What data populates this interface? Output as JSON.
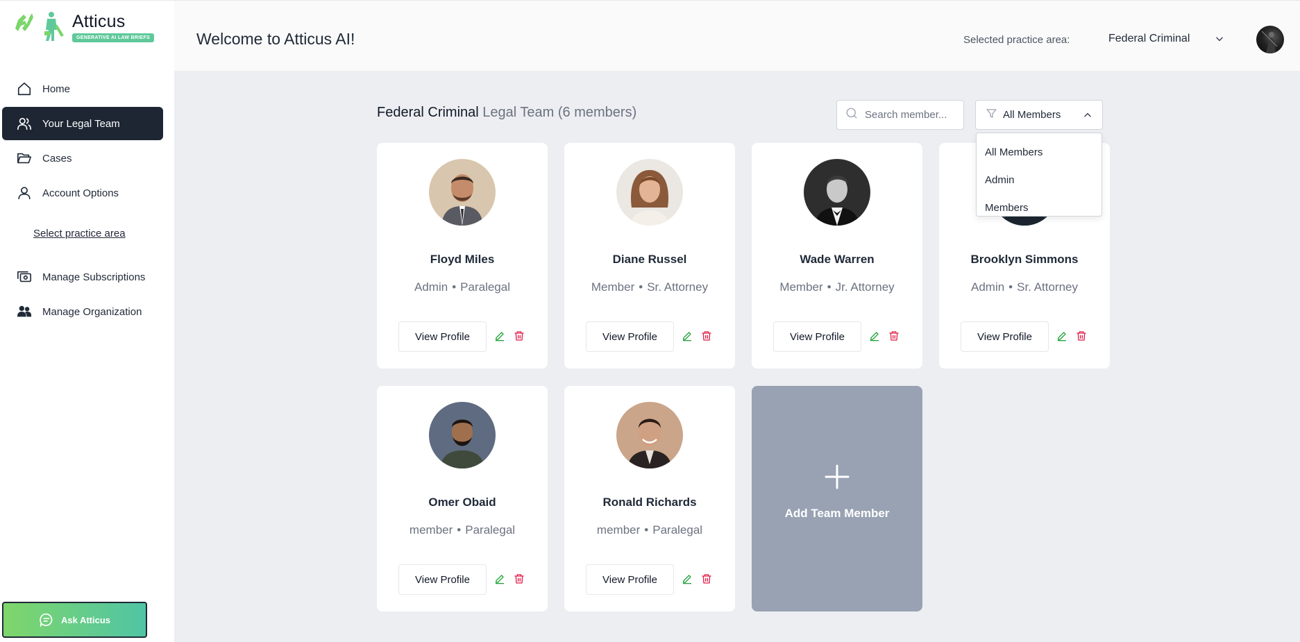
{
  "app": {
    "name": "Atticus",
    "tagline": "GENERATIVE AI LAW BRIEFS"
  },
  "sidebar": {
    "items": [
      {
        "label": "Home",
        "icon": "home-icon"
      },
      {
        "label": "Your Legal Team",
        "icon": "users-icon"
      },
      {
        "label": "Cases",
        "icon": "folder-open-icon"
      },
      {
        "label": "Account Options",
        "icon": "user-icon"
      }
    ],
    "practice_link": "Select practice area",
    "items2": [
      {
        "label": "Manage Subscriptions",
        "icon": "subscriptions-icon"
      },
      {
        "label": "Manage Organization",
        "icon": "organization-icon"
      }
    ],
    "ask_button": "Ask Atticus"
  },
  "header": {
    "welcome": "Welcome to Atticus AI!",
    "practice_label": "Selected practice area:",
    "practice_value": "Federal Criminal"
  },
  "team": {
    "area": "Federal Criminal",
    "suffix": "Legal Team (6 members)",
    "search_placeholder": "Search member...",
    "filter_value": "All Members",
    "filter_options": [
      "All Members",
      "Admin",
      "Members"
    ],
    "view_profile_label": "View Profile",
    "add_label": "Add Team Member",
    "members": [
      {
        "name": "Floyd Miles",
        "type": "Admin",
        "role": "Paralegal"
      },
      {
        "name": "Diane Russel",
        "type": "Member",
        "role": "Sr. Attorney"
      },
      {
        "name": "Wade Warren",
        "type": "Member",
        "role": "Jr. Attorney"
      },
      {
        "name": "Brooklyn Simmons",
        "type": "Admin",
        "role": "Sr. Attorney"
      },
      {
        "name": "Omer Obaid",
        "type": "member",
        "role": "Paralegal"
      },
      {
        "name": "Ronald Richards",
        "type": "member",
        "role": "Paralegal"
      }
    ]
  },
  "colors": {
    "sidebar_active": "#1e2633",
    "accent_green": "#5fc99a",
    "edit_icon": "#22a33a",
    "delete_icon": "#e11d48",
    "add_card": "#98a2b3"
  }
}
